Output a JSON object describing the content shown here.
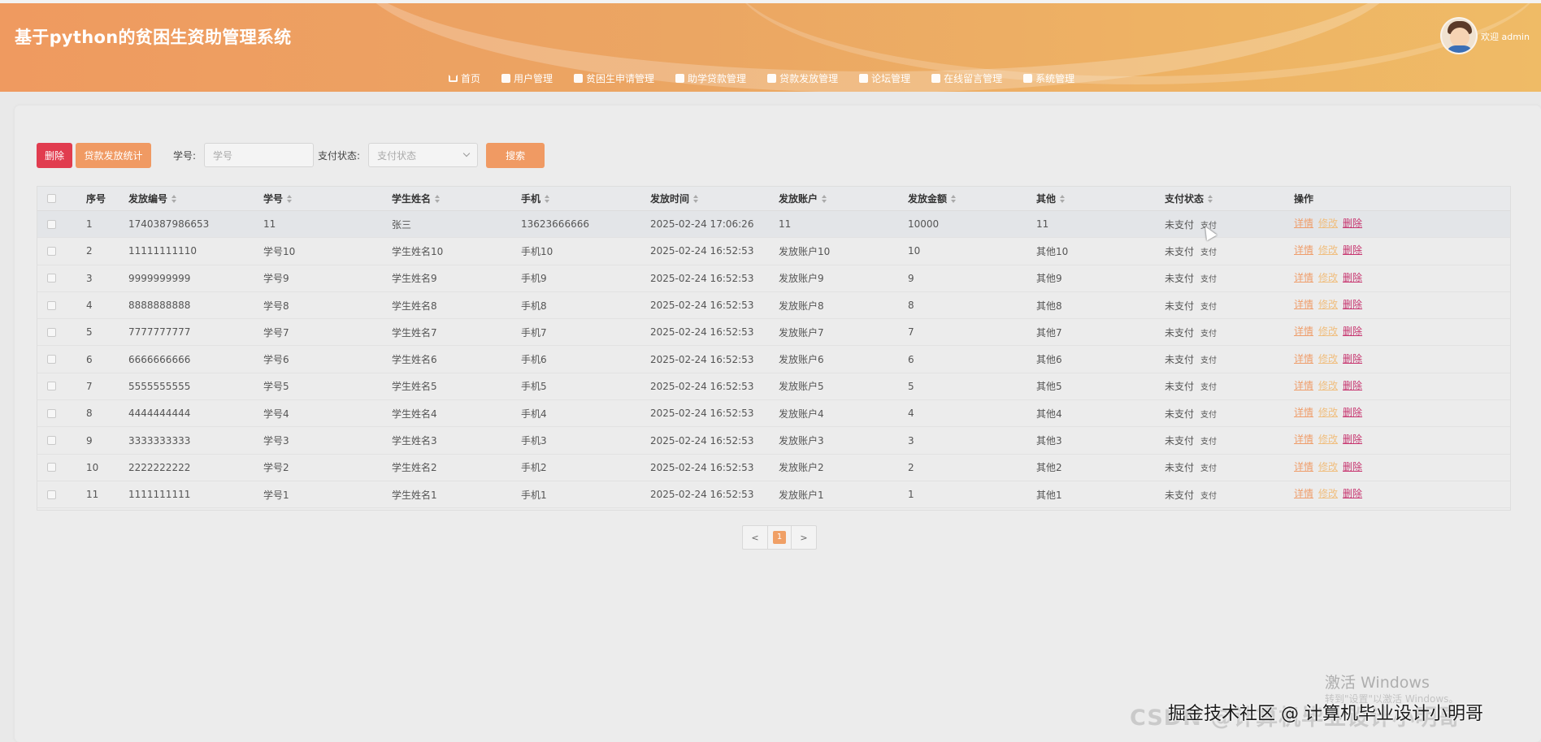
{
  "header": {
    "title": "基于python的贫困生资助管理系统",
    "welcome": "欢迎 admin"
  },
  "nav": [
    {
      "label": "首页",
      "icon": "home-icon"
    },
    {
      "label": "用户管理",
      "icon": "user-icon"
    },
    {
      "label": "贫困生申请管理",
      "icon": "apply-icon"
    },
    {
      "label": "助学贷款管理",
      "icon": "loan-icon"
    },
    {
      "label": "贷款发放管理",
      "icon": "disburse-icon"
    },
    {
      "label": "论坛管理",
      "icon": "forum-icon"
    },
    {
      "label": "在线留言管理",
      "icon": "message-icon"
    },
    {
      "label": "系统管理",
      "icon": "system-icon"
    }
  ],
  "toolbar": {
    "delete_label": "删除",
    "stats_label": "贷款发放统计",
    "student_id_label": "学号:",
    "student_id_placeholder": "学号",
    "pay_status_label": "支付状态:",
    "pay_status_placeholder": "支付状态",
    "search_label": "搜索"
  },
  "table": {
    "columns": [
      "序号",
      "发放编号",
      "学号",
      "学生姓名",
      "手机",
      "发放时间",
      "发放账户",
      "发放金额",
      "其他",
      "支付状态",
      "操作"
    ],
    "rows": [
      {
        "no": "1",
        "code": "1740387986653",
        "sid": "11",
        "name": "张三",
        "phone": "13623666666",
        "time": "2025-02-24 17:06:26",
        "account": "11",
        "amount": "10000",
        "other": "11",
        "status": "未支付",
        "pay": "支付"
      },
      {
        "no": "2",
        "code": "11111111110",
        "sid": "学号10",
        "name": "学生姓名10",
        "phone": "手机10",
        "time": "2025-02-24 16:52:53",
        "account": "发放账户10",
        "amount": "10",
        "other": "其他10",
        "status": "未支付",
        "pay": "支付"
      },
      {
        "no": "3",
        "code": "9999999999",
        "sid": "学号9",
        "name": "学生姓名9",
        "phone": "手机9",
        "time": "2025-02-24 16:52:53",
        "account": "发放账户9",
        "amount": "9",
        "other": "其他9",
        "status": "未支付",
        "pay": "支付"
      },
      {
        "no": "4",
        "code": "8888888888",
        "sid": "学号8",
        "name": "学生姓名8",
        "phone": "手机8",
        "time": "2025-02-24 16:52:53",
        "account": "发放账户8",
        "amount": "8",
        "other": "其他8",
        "status": "未支付",
        "pay": "支付"
      },
      {
        "no": "5",
        "code": "7777777777",
        "sid": "学号7",
        "name": "学生姓名7",
        "phone": "手机7",
        "time": "2025-02-24 16:52:53",
        "account": "发放账户7",
        "amount": "7",
        "other": "其他7",
        "status": "未支付",
        "pay": "支付"
      },
      {
        "no": "6",
        "code": "6666666666",
        "sid": "学号6",
        "name": "学生姓名6",
        "phone": "手机6",
        "time": "2025-02-24 16:52:53",
        "account": "发放账户6",
        "amount": "6",
        "other": "其他6",
        "status": "未支付",
        "pay": "支付"
      },
      {
        "no": "7",
        "code": "5555555555",
        "sid": "学号5",
        "name": "学生姓名5",
        "phone": "手机5",
        "time": "2025-02-24 16:52:53",
        "account": "发放账户5",
        "amount": "5",
        "other": "其他5",
        "status": "未支付",
        "pay": "支付"
      },
      {
        "no": "8",
        "code": "4444444444",
        "sid": "学号4",
        "name": "学生姓名4",
        "phone": "手机4",
        "time": "2025-02-24 16:52:53",
        "account": "发放账户4",
        "amount": "4",
        "other": "其他4",
        "status": "未支付",
        "pay": "支付"
      },
      {
        "no": "9",
        "code": "3333333333",
        "sid": "学号3",
        "name": "学生姓名3",
        "phone": "手机3",
        "time": "2025-02-24 16:52:53",
        "account": "发放账户3",
        "amount": "3",
        "other": "其他3",
        "status": "未支付",
        "pay": "支付"
      },
      {
        "no": "10",
        "code": "2222222222",
        "sid": "学号2",
        "name": "学生姓名2",
        "phone": "手机2",
        "time": "2025-02-24 16:52:53",
        "account": "发放账户2",
        "amount": "2",
        "other": "其他2",
        "status": "未支付",
        "pay": "支付"
      },
      {
        "no": "11",
        "code": "1111111111",
        "sid": "学号1",
        "name": "学生姓名1",
        "phone": "手机1",
        "time": "2025-02-24 16:52:53",
        "account": "发放账户1",
        "amount": "1",
        "other": "其他1",
        "status": "未支付",
        "pay": "支付"
      }
    ],
    "actions": {
      "detail": "详情",
      "edit": "修改",
      "delete": "删除"
    }
  },
  "pagination": {
    "prev": "<",
    "current": "1",
    "next": ">"
  },
  "watermarks": {
    "windows_title": "激活 Windows",
    "windows_hint": "转到\"设置\"以激活 Windows。",
    "csdn": "CSDN @计算机毕业设计小明哥",
    "juejin": "掘金技术社区 @ 计算机毕业设计小明哥"
  },
  "colors": {
    "header_start": "#ef9a60",
    "header_end": "#efbb66",
    "delete_button": "#e13c4f",
    "accent_button": "#f09a63",
    "action_delete": "#c7356f"
  }
}
